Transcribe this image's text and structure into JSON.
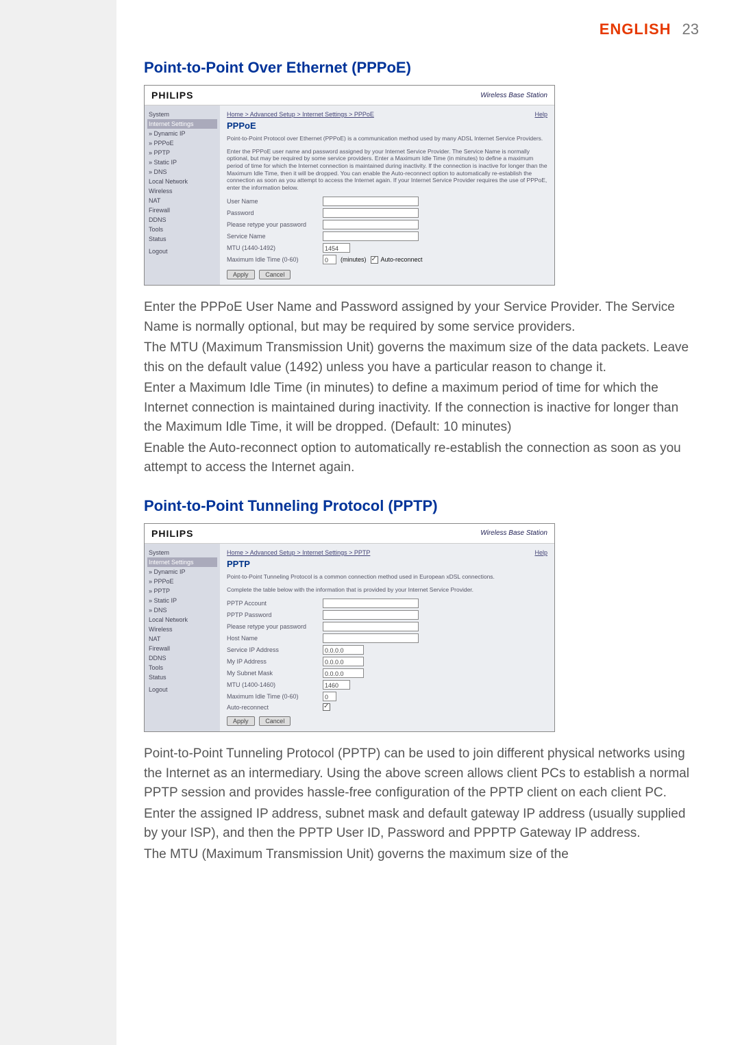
{
  "header": {
    "language": "ENGLISH",
    "page_number": "23"
  },
  "section1": {
    "title": "Point-to-Point Over Ethernet (PPPoE)",
    "brand": "PHILIPS",
    "station": "Wireless Base Station",
    "nav": {
      "items": [
        "System",
        "Internet Settings",
        "» Dynamic IP",
        "» PPPoE",
        "» PPTP",
        "» Static IP",
        "» DNS",
        "Local Network",
        "Wireless",
        "NAT",
        "Firewall",
        "DDNS",
        "Tools",
        "Status",
        "",
        "Logout"
      ]
    },
    "crumb": "Home > Advanced Setup > Internet Settings > PPPoE",
    "help": "Help",
    "panel_title": "PPPoE",
    "panel_desc_a": "Point-to-Point Protocol over Ethernet (PPPoE) is a communication method used by many ADSL Internet Service Providers.",
    "panel_desc_b": "Enter the PPPoE user name and password assigned by your Internet Service Provider. The Service Name is normally optional, but may be required by some service providers. Enter a Maximum Idle Time (in minutes) to define a maximum period of time for which the Internet connection is maintained during inactivity. If the connection is inactive for longer than the Maximum Idle Time, then it will be dropped. You can enable the Auto-reconnect option to automatically re-establish the connection as soon as you attempt to access the Internet again. If your Internet Service Provider requires the use of PPPoE, enter the information below.",
    "form": {
      "username": {
        "label": "User Name",
        "value": ""
      },
      "password": {
        "label": "Password",
        "value": ""
      },
      "retype": {
        "label": "Please retype your password",
        "value": ""
      },
      "service": {
        "label": "Service Name",
        "value": ""
      },
      "mtu": {
        "label": "MTU (1440-1492)",
        "value": "1454"
      },
      "idle": {
        "label": "Maximum Idle Time (0-60)",
        "value": "0",
        "suffix": "(minutes)",
        "auto_label": "Auto-reconnect"
      }
    },
    "buttons": {
      "apply": "Apply",
      "cancel": "Cancel"
    },
    "body_paragraphs": [
      "Enter the PPPoE User Name and Password assigned by your Service Provider. The Service Name is normally optional, but may be required by some service providers.",
      "The MTU (Maximum Transmission Unit) governs the maximum size of the data packets. Leave this on the default value (1492) unless you have a particular reason to change it.",
      "Enter a Maximum Idle Time (in minutes) to define a maximum period of time for which the Internet connection is maintained during inactivity. If the connection is inactive for longer than the Maximum Idle Time, it will be dropped. (Default: 10 minutes)",
      "Enable the Auto-reconnect option to automatically re-establish the connection as soon as you attempt to access the Internet again."
    ]
  },
  "section2": {
    "title": "Point-to-Point Tunneling Protocol (PPTP)",
    "brand": "PHILIPS",
    "station": "Wireless Base Station",
    "nav": {
      "items": [
        "System",
        "Internet Settings",
        "» Dynamic IP",
        "» PPPoE",
        "» PPTP",
        "» Static IP",
        "» DNS",
        "Local Network",
        "Wireless",
        "NAT",
        "Firewall",
        "DDNS",
        "Tools",
        "Status",
        "",
        "Logout"
      ]
    },
    "crumb": "Home > Advanced Setup > Internet Settings > PPTP",
    "help": "Help",
    "panel_title": "PPTP",
    "panel_desc_a": "Point-to-Point Tunneling Protocol is a common connection method used in European xDSL connections.",
    "panel_desc_b": "Complete the table below with the information that is provided by your Internet Service Provider.",
    "form": {
      "account": {
        "label": "PPTP Account",
        "value": ""
      },
      "password": {
        "label": "PPTP Password",
        "value": ""
      },
      "retype": {
        "label": "Please retype your password",
        "value": ""
      },
      "hostname": {
        "label": "Host Name",
        "value": ""
      },
      "serviceip": {
        "label": "Service IP Address",
        "value": "0.0.0.0"
      },
      "myip": {
        "label": "My IP Address",
        "value": "0.0.0.0"
      },
      "subnet": {
        "label": "My Subnet Mask",
        "value": "0.0.0.0"
      },
      "mtu": {
        "label": "MTU (1400-1460)",
        "value": "1460"
      },
      "idle": {
        "label": "Maximum Idle Time (0-60)",
        "value": "0"
      },
      "auto": {
        "label": "Auto-reconnect"
      }
    },
    "buttons": {
      "apply": "Apply",
      "cancel": "Cancel"
    },
    "body_paragraphs": [
      "Point-to-Point Tunneling Protocol (PPTP) can be used to join different physical networks using the Internet as an intermediary. Using the above screen allows client PCs to establish a normal PPTP session and provides hassle-free configuration of the PPTP client on each client PC.",
      "Enter the assigned IP address, subnet mask and default gateway IP address (usually supplied by your ISP), and then the PPTP User ID, Password and PPPTP Gateway IP address.",
      "The MTU (Maximum Transmission Unit) governs the maximum size of the"
    ]
  }
}
